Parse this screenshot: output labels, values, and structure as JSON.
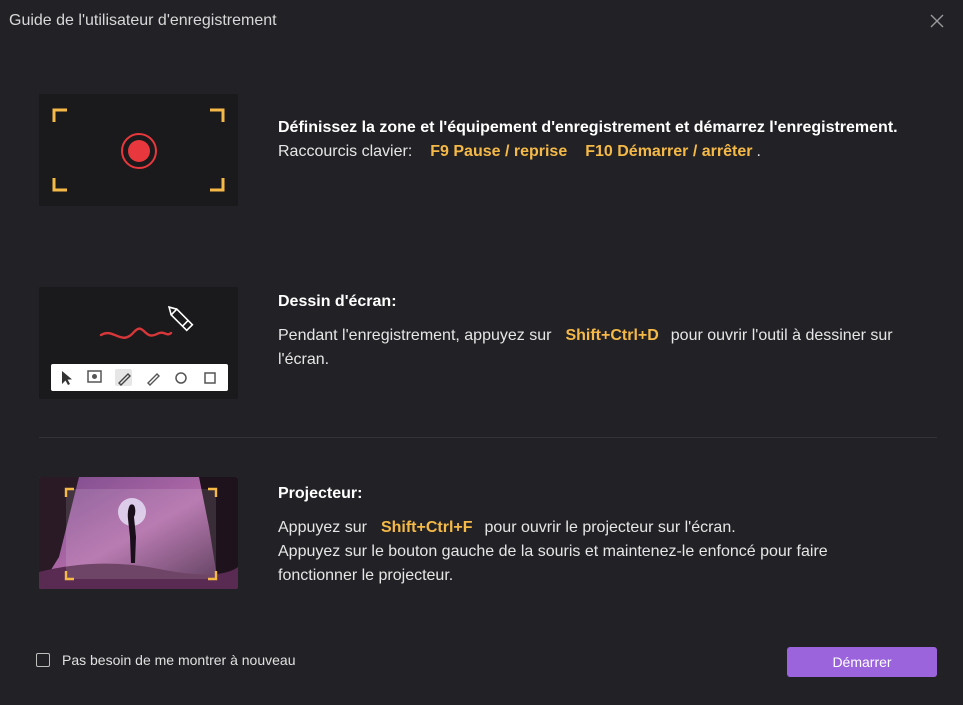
{
  "window": {
    "title": "Guide de l'utilisateur d'enregistrement",
    "close_icon": "close-icon"
  },
  "sections": [
    {
      "heading": "Définissez la zone et l'équipement d'enregistrement et démarrez l'enregistrement.",
      "shortcut_prefix": "Raccourcis clavier:",
      "key1": "F9 Pause / reprise",
      "key2": "F10 Démarrer / arrêter",
      "suffix": "."
    },
    {
      "heading": "Dessin d'écran:",
      "body_prefix": "Pendant l'enregistrement, appuyez sur",
      "key": "Shift+Ctrl+D",
      "body_suffix": "pour ouvrir l'outil à dessiner sur l'écran."
    },
    {
      "heading": "Projecteur:",
      "line1_prefix": "Appuyez sur",
      "key": "Shift+Ctrl+F",
      "line1_suffix": "pour ouvrir le projecteur sur l'écran.",
      "line2": "Appuyez sur le bouton gauche de la souris et maintenez-le enfoncé pour faire fonctionner le projecteur."
    }
  ],
  "footer": {
    "checkbox_label": "Pas besoin de me montrer à nouveau",
    "checkbox_checked": false,
    "start_label": "Démarrer"
  },
  "colors": {
    "accent": "#9b63dc",
    "shortcut": "#f5b947",
    "record": "#e8383d",
    "background": "#222226"
  }
}
